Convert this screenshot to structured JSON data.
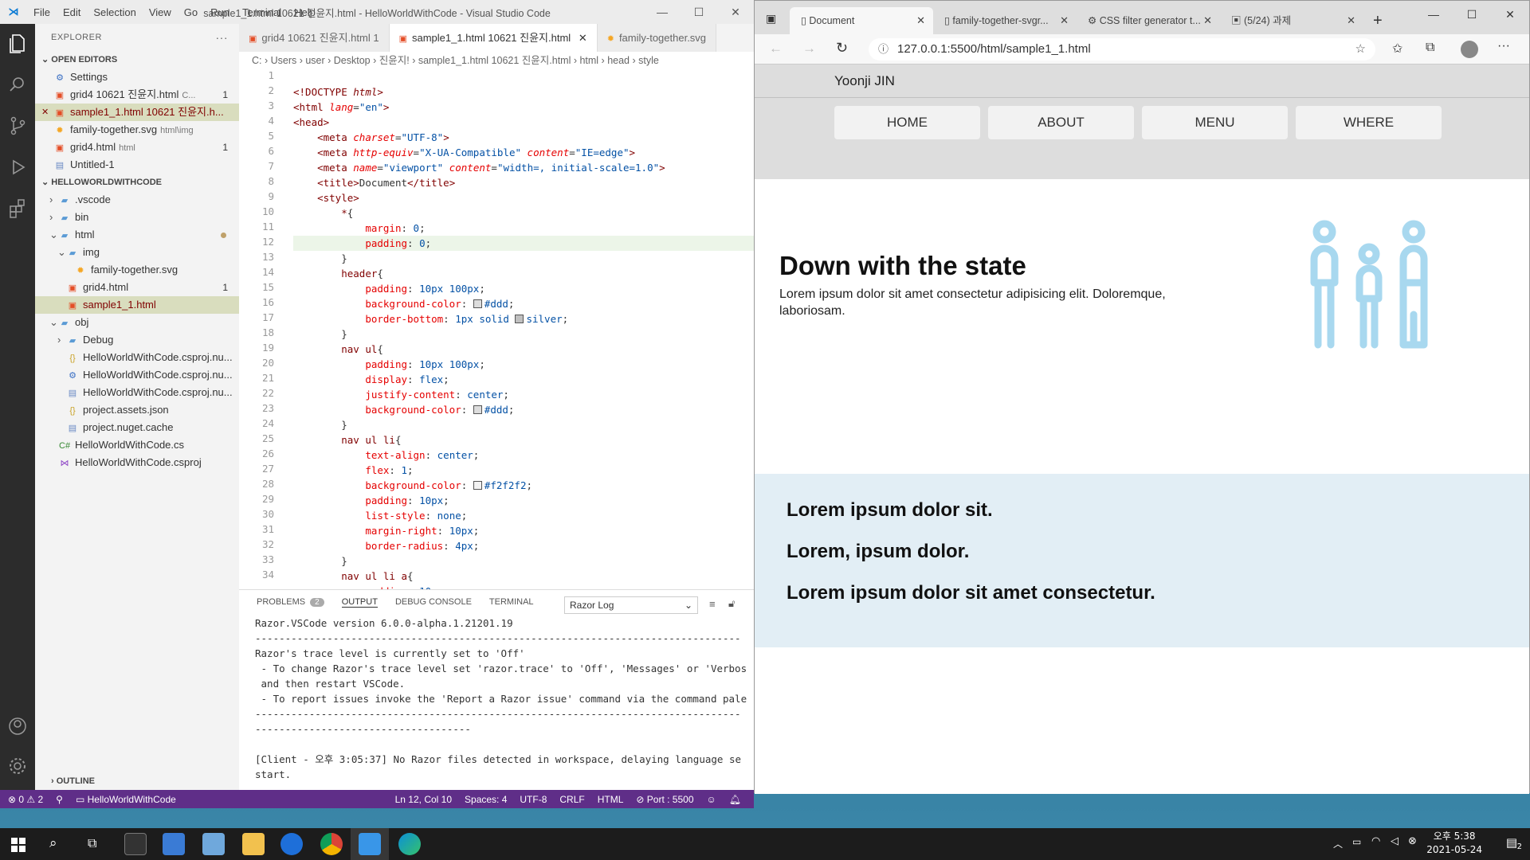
{
  "vscode": {
    "menu": [
      "File",
      "Edit",
      "Selection",
      "View",
      "Go",
      "Run",
      "Terminal",
      "Help"
    ],
    "title": "sample1_1.html 10621 진윤지.html - HelloWorldWithCode - Visual Studio Code",
    "explorer_title": "EXPLORER",
    "open_editors_title": "OPEN EDITORS",
    "open_editors": [
      {
        "label": "Settings",
        "icon": "settings-file-icon",
        "badge": ""
      },
      {
        "label": "grid4 10621 진윤지.html",
        "sub": "C...",
        "icon": "html-file-icon",
        "badge": "1"
      },
      {
        "label": "sample1_1.html 10621 진윤지.h...",
        "icon": "html-file-icon",
        "badge": "",
        "active": true
      },
      {
        "label": "family-together.svg",
        "sub": "html\\img",
        "icon": "svg-file-icon",
        "badge": ""
      },
      {
        "label": "grid4.html",
        "sub": "html",
        "icon": "html-file-icon",
        "badge": "1"
      },
      {
        "label": "Untitled-1",
        "icon": "text-file-icon",
        "badge": ""
      }
    ],
    "workspace_title": "HELLOWORLDWITHCODE",
    "tree": [
      {
        "label": ".vscode",
        "indent": 1,
        "type": "folder",
        "chev": "›"
      },
      {
        "label": "bin",
        "indent": 1,
        "type": "folder",
        "chev": "›"
      },
      {
        "label": "html",
        "indent": 1,
        "type": "folder",
        "chev": "⌄",
        "dot": true
      },
      {
        "label": "img",
        "indent": 2,
        "type": "folder",
        "chev": "⌄"
      },
      {
        "label": "family-together.svg",
        "indent": 3,
        "type": "svg"
      },
      {
        "label": "grid4.html",
        "indent": 2,
        "type": "html",
        "badge": "1"
      },
      {
        "label": "sample1_1.html",
        "indent": 2,
        "type": "html",
        "active": true
      },
      {
        "label": "obj",
        "indent": 1,
        "type": "folder",
        "chev": "⌄"
      },
      {
        "label": "Debug",
        "indent": 2,
        "type": "folder",
        "chev": "›"
      },
      {
        "label": "HelloWorldWithCode.csproj.nu...",
        "indent": 2,
        "type": "json"
      },
      {
        "label": "HelloWorldWithCode.csproj.nu...",
        "indent": 2,
        "type": "gear"
      },
      {
        "label": "HelloWorldWithCode.csproj.nu...",
        "indent": 2,
        "type": "file"
      },
      {
        "label": "project.assets.json",
        "indent": 2,
        "type": "json"
      },
      {
        "label": "project.nuget.cache",
        "indent": 2,
        "type": "file"
      },
      {
        "label": "HelloWorldWithCode.cs",
        "indent": 1,
        "type": "cs"
      },
      {
        "label": "HelloWorldWithCode.csproj",
        "indent": 1,
        "type": "csproj"
      }
    ],
    "outline_label": "OUTLINE",
    "tabs": [
      {
        "label": "grid4 10621 진윤지.html 1",
        "active": false
      },
      {
        "label": "sample1_1.html 10621 진윤지.html",
        "active": true
      },
      {
        "label": "family-together.svg",
        "active": false
      }
    ],
    "breadcrumb": "C: › Users › user › Desktop › 진윤지! › sample1_1.html 10621 진윤지.html › html › head › style",
    "line_numbers": [
      "1",
      "2",
      "3",
      "4",
      "5",
      "6",
      "7",
      "8",
      "9",
      "10",
      "11",
      "12",
      "13",
      "14",
      "15",
      "16",
      "17",
      "18",
      "19",
      "20",
      "21",
      "22",
      "23",
      "24",
      "25",
      "26",
      "27",
      "28",
      "29",
      "30",
      "31",
      "32",
      "33",
      "34"
    ],
    "panel_tabs": [
      "PROBLEMS",
      "OUTPUT",
      "DEBUG CONSOLE",
      "TERMINAL"
    ],
    "problems_count": "2",
    "output_select": "Razor Log",
    "output_text": "Razor.VSCode version 6.0.0-alpha.1.21201.19\n---------------------------------------------------------------------------------\nRazor's trace level is currently set to 'Off'\n - To change Razor's trace level set 'razor.trace' to 'Off', 'Messages' or 'Verbos\n and then restart VSCode.\n - To report issues invoke the 'Report a Razor issue' command via the command pale\n---------------------------------------------------------------------------------\n------------------------------------\n\n[Client - 오후 3:05:37] No Razor files detected in workspace, delaying language se\nstart.",
    "status": {
      "errors": "⊗ 0 ⚠ 2",
      "project": "HelloWorldWithCode",
      "position": "Ln 12, Col 10",
      "spaces": "Spaces: 4",
      "encoding": "UTF-8",
      "eol": "CRLF",
      "language": "HTML",
      "port": "⊘ Port : 5500"
    }
  },
  "browser": {
    "tabs": [
      {
        "label": "Document",
        "active": true
      },
      {
        "label": "family-together-svgr..."
      },
      {
        "label": "CSS filter generator t..."
      },
      {
        "label": "(5/24) 과제"
      }
    ],
    "url": "127.0.0.1:5500/html/sample1_1.html",
    "page": {
      "header_name": "Yoonji JIN",
      "nav": [
        "HOME",
        "ABOUT",
        "MENU",
        "WHERE"
      ],
      "hero_title": "Down with the state",
      "hero_text": "Lorem ipsum dolor sit amet consectetur adipisicing elit. Doloremque, laboriosam.",
      "band_items": [
        "Lorem ipsum dolor sit.",
        "Lorem, ipsum dolor.",
        "Lorem ipsum dolor sit amet consectetur."
      ],
      "icon_color": "#a8d8ef"
    }
  },
  "taskbar": {
    "time": "오후 5:38",
    "date": "2021-05-24",
    "notification_count": "2"
  }
}
